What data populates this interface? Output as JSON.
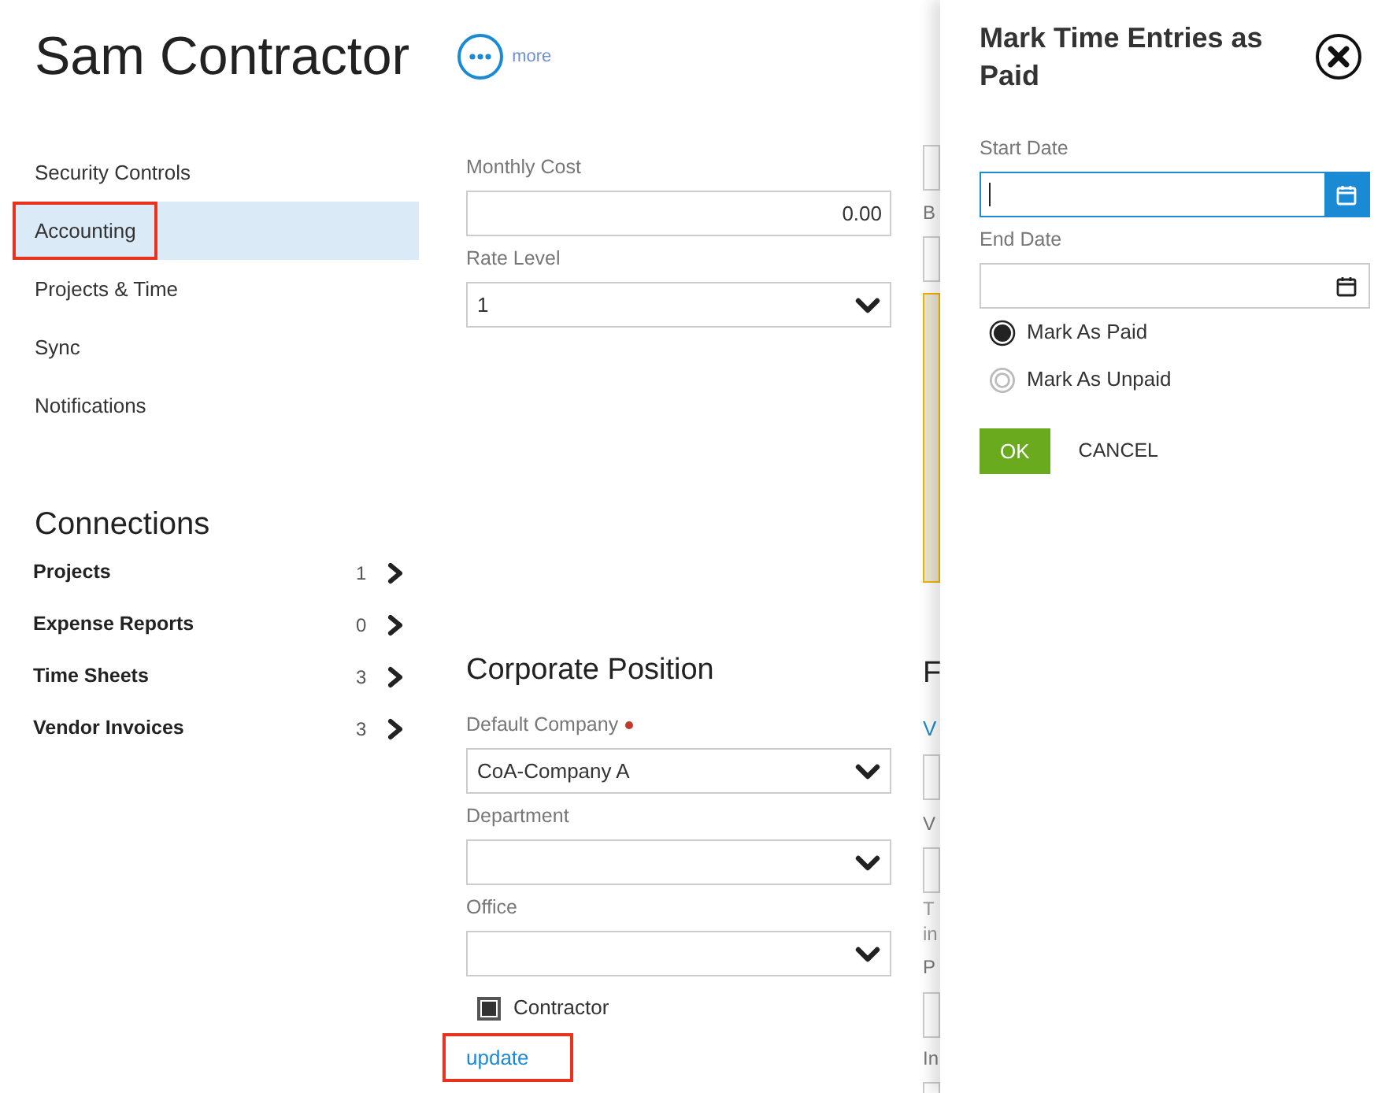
{
  "header": {
    "title": "Sam Contractor",
    "more_label": "more"
  },
  "nav": [
    {
      "label": "Security Controls",
      "selected": false,
      "annotated": false
    },
    {
      "label": "Accounting",
      "selected": true,
      "annotated": true
    },
    {
      "label": "Projects & Time",
      "selected": false,
      "annotated": false
    },
    {
      "label": "Sync",
      "selected": false,
      "annotated": false
    },
    {
      "label": "Notifications",
      "selected": false,
      "annotated": false
    }
  ],
  "connections": {
    "title": "Connections",
    "items": [
      {
        "label": "Projects",
        "count": "1"
      },
      {
        "label": "Expense Reports",
        "count": "0"
      },
      {
        "label": "Time Sheets",
        "count": "3"
      },
      {
        "label": "Vendor Invoices",
        "count": "3"
      }
    ]
  },
  "accounting_form": {
    "fields": [
      {
        "kind": "text",
        "label": "Monthly Cost",
        "value": "0.00"
      },
      {
        "kind": "select",
        "label": "Rate Level",
        "value": "1"
      }
    ]
  },
  "corporate_position": {
    "title": "Corporate Position",
    "fields": [
      {
        "kind": "select",
        "label": "Default Company",
        "required": true,
        "value": "CoA-Company A"
      },
      {
        "kind": "select",
        "label": "Department",
        "required": false
      },
      {
        "kind": "select",
        "label": "Office",
        "required": false
      }
    ],
    "contractor": {
      "label": "Contractor",
      "checked": true
    },
    "update_link": {
      "label": "update",
      "annotated": true
    }
  },
  "side_column": [
    {
      "kind": "input"
    },
    {
      "kind": "label",
      "text": "B"
    },
    {
      "kind": "input"
    },
    {
      "kind": "notice"
    },
    {
      "kind": "heading",
      "text": "F"
    },
    {
      "kind": "link",
      "text": "V"
    },
    {
      "kind": "input"
    },
    {
      "kind": "label",
      "text": "V"
    },
    {
      "kind": "input"
    },
    {
      "kind": "hint",
      "text": "T"
    },
    {
      "kind": "hint",
      "text": "in"
    },
    {
      "kind": "label",
      "text": "P"
    },
    {
      "kind": "input"
    },
    {
      "kind": "label",
      "text": "In"
    },
    {
      "kind": "input"
    }
  ],
  "dialog": {
    "title": "Mark Time Entries as Paid",
    "fields": [
      {
        "label": "Start Date",
        "focused": true
      },
      {
        "label": "End Date",
        "focused": false
      }
    ],
    "options": [
      {
        "label": "Mark As Paid",
        "selected": true
      },
      {
        "label": "Mark As Unpaid",
        "selected": false
      }
    ],
    "buttons": [
      {
        "kind": "primary",
        "label": "OK"
      },
      {
        "kind": "text",
        "label": "CANCEL"
      }
    ]
  }
}
